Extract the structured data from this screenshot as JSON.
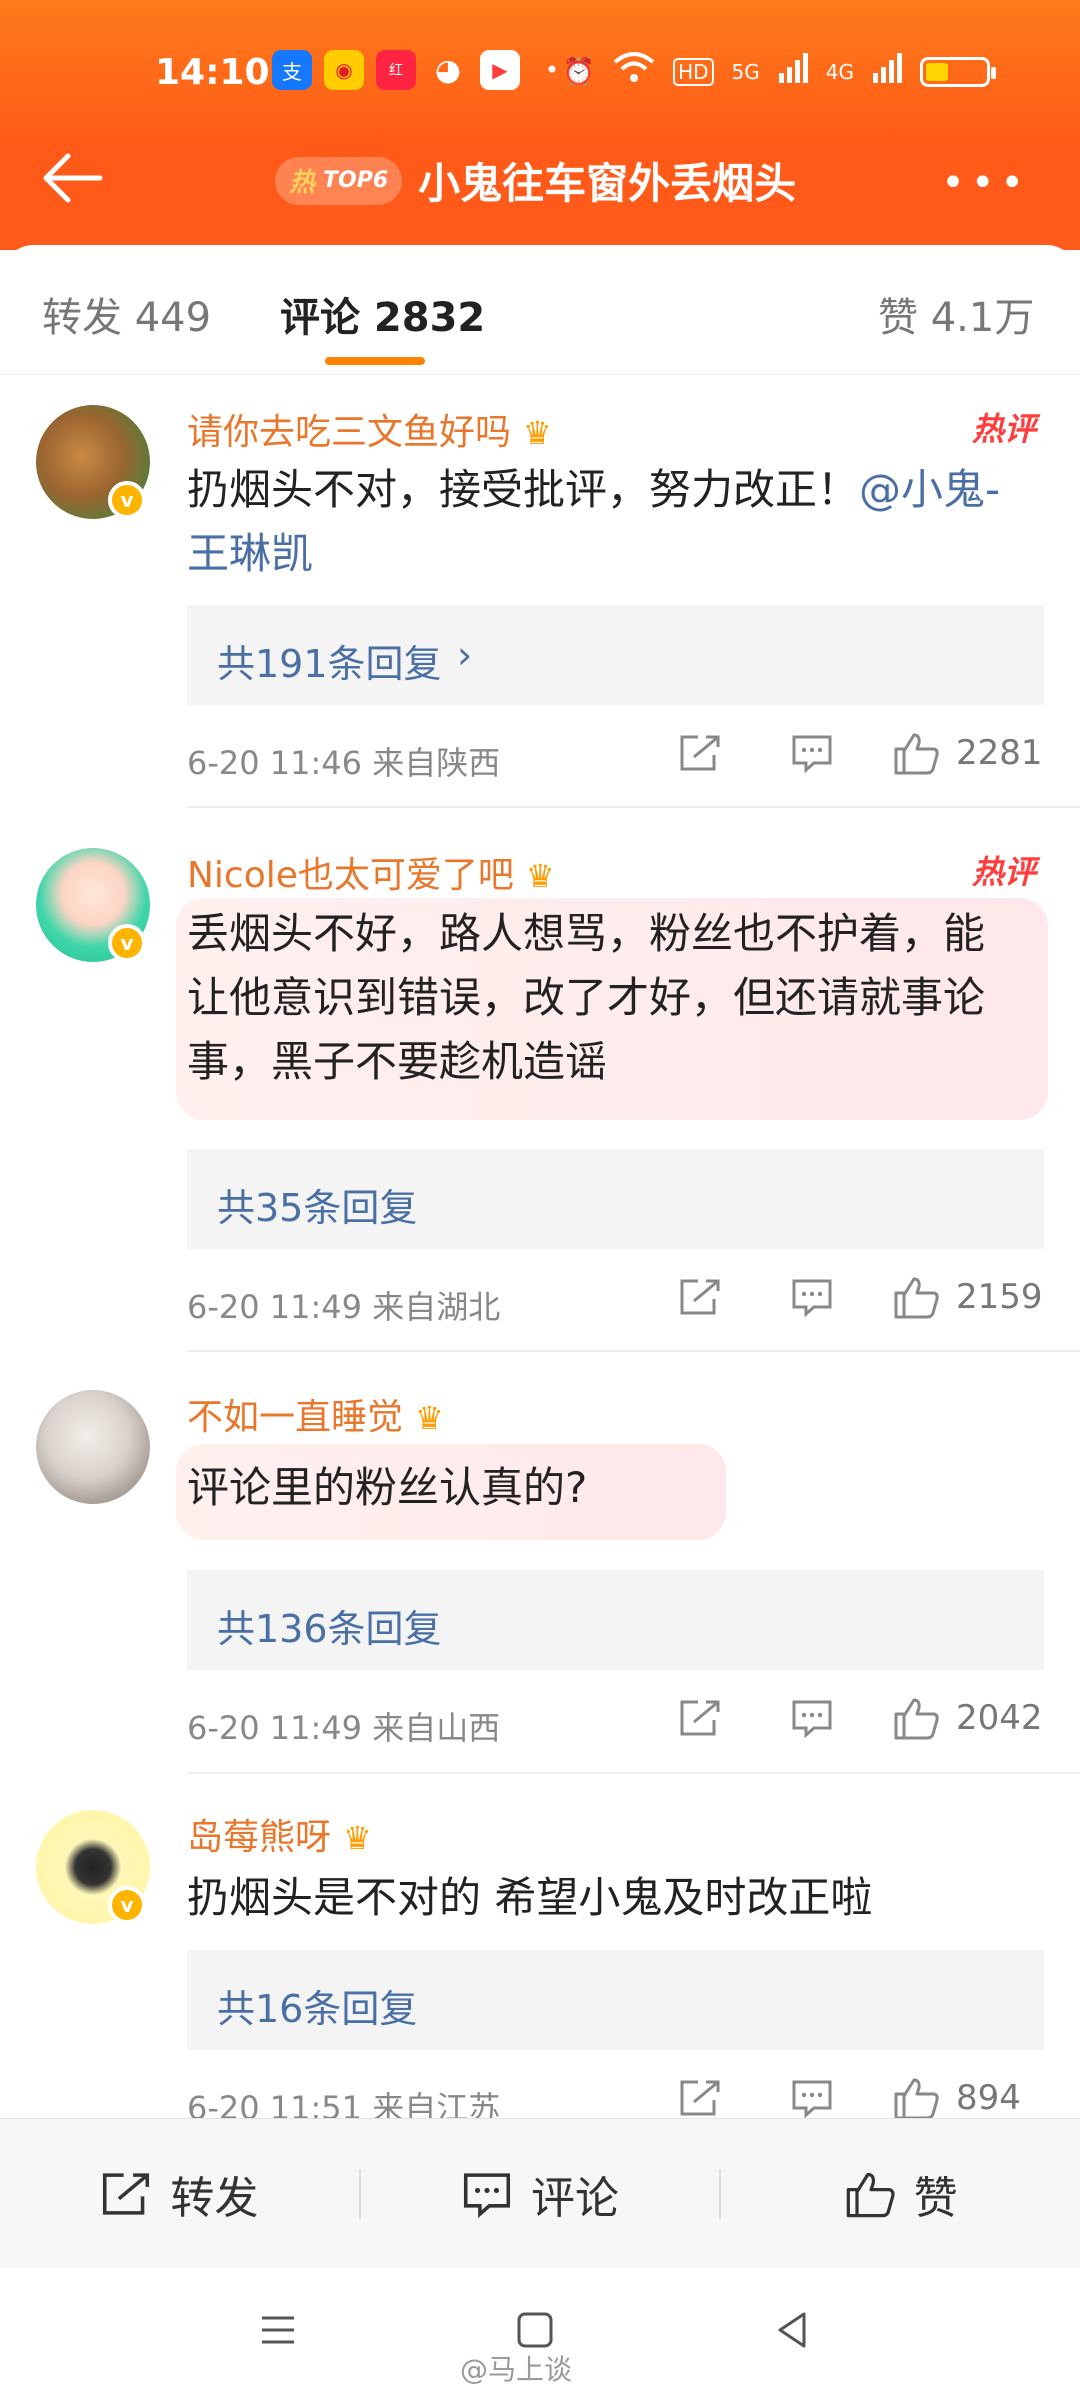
{
  "status_bar": {
    "time": "14:10",
    "network1": "5G",
    "network2": "4G"
  },
  "header": {
    "hot_badge_char": "热",
    "hot_badge_rank": "TOP6",
    "title": "小鬼往车窗外丢烟头"
  },
  "tabs": [
    {
      "label": "转发 449"
    },
    {
      "label": "评论 2832"
    },
    {
      "label": "赞 4.1万"
    }
  ],
  "comments": [
    {
      "username": "请你去吃三文鱼好吗",
      "hot_tag": "热评",
      "text_main": "扔烟头不对，接受批评，努力改正！",
      "text_mention": "@小鬼-王琳凯",
      "replies": "共191条回复",
      "meta": "6-20 11:46  来自陕西",
      "likes": "2281"
    },
    {
      "username": "Nicole也太可爱了吧",
      "hot_tag": "热评",
      "text_main": "丢烟头不好，路人想骂，粉丝也不护着，能让他意识到错误，改了才好，但还请就事论事，黑子不要趁机造谣",
      "replies": "共35条回复",
      "meta": "6-20 11:49  来自湖北",
      "likes": "2159"
    },
    {
      "username": "不如一直睡觉",
      "text_main": "评论里的粉丝认真的?",
      "replies": "共136条回复",
      "meta": "6-20 11:49  来自山西",
      "likes": "2042"
    },
    {
      "username": "岛莓熊呀",
      "text_main": "扔烟头是不对的 希望小鬼及时改正啦",
      "replies": "共16条回复",
      "meta": "6-20 11:51  来自江苏",
      "likes": "894"
    }
  ],
  "bottom_bar": {
    "repost": "转发",
    "comment": "评论",
    "like": "赞"
  },
  "watermark": "@马上谈"
}
